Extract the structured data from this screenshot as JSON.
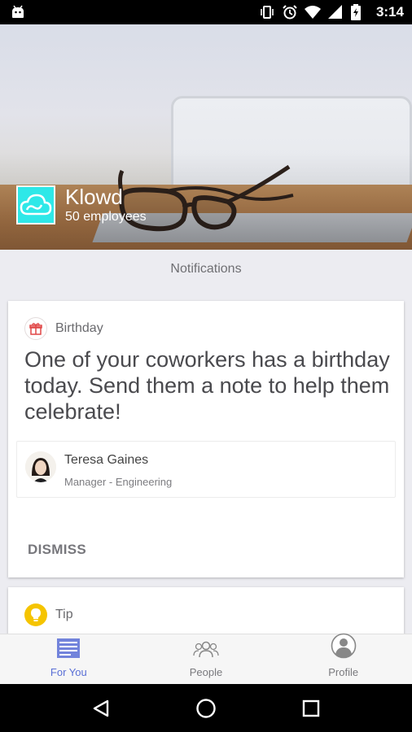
{
  "status_bar": {
    "time": "3:14",
    "icons": [
      "android-icon",
      "vibrate-icon",
      "alarm-icon",
      "wifi-icon",
      "signal-icon",
      "battery-icon"
    ]
  },
  "company": {
    "name": "Klowd",
    "employees": "50 employees",
    "logo_icon": "cloud-icon",
    "logo_color": "#2ee8e8"
  },
  "section_title": "Notifications",
  "birthday_card": {
    "label": "Birthday",
    "icon": "gift-icon",
    "message": "One of your coworkers has a birthday today. Send them a note to help them celebrate!",
    "person": {
      "name": "Teresa Gaines",
      "role": "Manager - Engineering"
    },
    "dismiss_label": "DISMISS"
  },
  "tip_card": {
    "label": "Tip",
    "icon": "lightbulb-icon",
    "icon_color": "#f5c400"
  },
  "bottom_nav": {
    "items": [
      {
        "label": "For You",
        "icon": "news-feed-icon",
        "active": true
      },
      {
        "label": "People",
        "icon": "people-icon",
        "active": false
      },
      {
        "label": "Profile",
        "icon": "profile-icon",
        "active": false
      }
    ],
    "active_color": "#5a6fd6"
  },
  "system_nav": {
    "icons": [
      "back-icon",
      "home-icon",
      "recents-icon"
    ]
  }
}
